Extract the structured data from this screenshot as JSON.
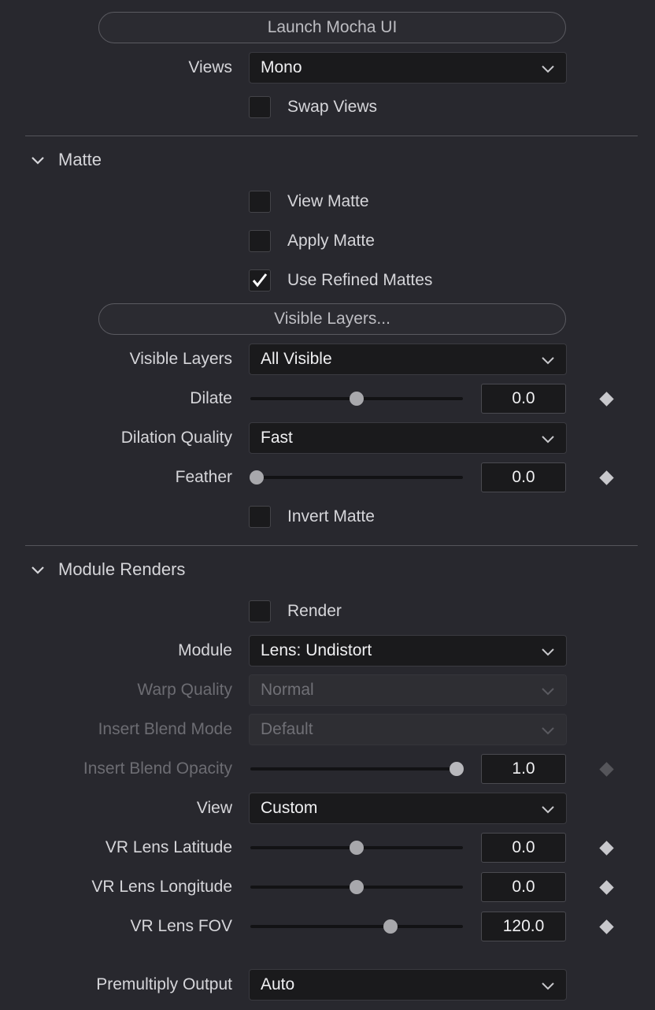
{
  "top": {
    "launch_button": "Launch Mocha UI",
    "views_label": "Views",
    "views_value": "Mono",
    "swap_views": "Swap Views"
  },
  "matte": {
    "title": "Matte",
    "view_matte": "View Matte",
    "apply_matte": "Apply Matte",
    "use_refined": "Use Refined Mattes",
    "use_refined_checked": true,
    "visible_layers_button": "Visible Layers...",
    "visible_layers_label": "Visible Layers",
    "visible_layers_value": "All Visible",
    "dilate_label": "Dilate",
    "dilate_value": "0.0",
    "dilate_level": 0.5,
    "dilation_quality_label": "Dilation Quality",
    "dilation_quality_value": "Fast",
    "feather_label": "Feather",
    "feather_value": "0.0",
    "feather_level": 0.0,
    "invert_matte": "Invert Matte"
  },
  "module_renders": {
    "title": "Module Renders",
    "render": "Render",
    "module_label": "Module",
    "module_value": "Lens: Undistort",
    "warp_quality_label": "Warp Quality",
    "warp_quality_value": "Normal",
    "insert_blend_mode_label": "Insert Blend Mode",
    "insert_blend_mode_value": "Default",
    "insert_blend_opacity_label": "Insert Blend Opacity",
    "insert_blend_opacity_value": "1.0",
    "insert_blend_opacity_level": 1.0,
    "view_label": "View",
    "view_value": "Custom",
    "latitude_label": "VR Lens Latitude",
    "latitude_value": "0.0",
    "latitude_level": 0.5,
    "longitude_label": "VR Lens Longitude",
    "longitude_value": "0.0",
    "longitude_level": 0.5,
    "fov_label": "VR Lens FOV",
    "fov_value": "120.0",
    "fov_level": 0.67,
    "premultiply_label": "Premultiply Output",
    "premultiply_value": "Auto"
  },
  "icons": {
    "dropdown": "chevron-down-icon",
    "section": "chevron-down-icon",
    "keyframe": "diamond-icon",
    "check": "checkmark-icon"
  }
}
